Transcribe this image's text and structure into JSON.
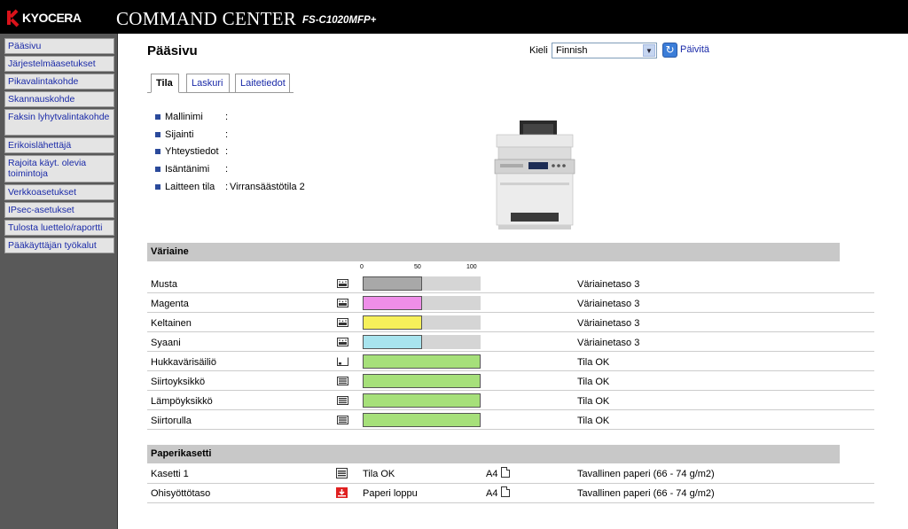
{
  "header": {
    "brand": "KYOCERA",
    "app_title": "COMMAND CENTER",
    "model": "FS-C1020MFP+"
  },
  "sidebar": {
    "items": [
      {
        "label": "Pääsivu"
      },
      {
        "label": "Järjestelmäasetukset"
      },
      {
        "label": "Pikavalintakohde"
      },
      {
        "label": "Skannauskohde"
      },
      {
        "label": "Faksin lyhytvalintakohde"
      },
      {
        "label": "Erikoislähettäjä"
      },
      {
        "label": "Rajoita käyt. olevia toimintoja"
      },
      {
        "label": "Verkkoasetukset"
      },
      {
        "label": "IPsec-asetukset"
      },
      {
        "label": "Tulosta luettelo/raportti"
      },
      {
        "label": "Pääkäyttäjän työkalut"
      }
    ]
  },
  "main": {
    "title": "Pääsivu",
    "language_label": "Kieli",
    "language_value": "Finnish",
    "refresh_label": "Päivitä",
    "tabs": [
      {
        "label": "Tila",
        "active": true
      },
      {
        "label": "Laskuri",
        "active": false
      },
      {
        "label": "Laitetiedot",
        "active": false
      }
    ],
    "info": [
      {
        "label": "Mallinimi",
        "sep": ":",
        "value": ""
      },
      {
        "label": "Sijainti",
        "sep": ":",
        "value": ""
      },
      {
        "label": "Yhteystiedot",
        "sep": ":",
        "value": ""
      },
      {
        "label": "Isäntänimi",
        "sep": ":",
        "value": ""
      },
      {
        "label": "Laitteen tila",
        "sep": ":",
        "value": "Virransäästötila 2"
      }
    ]
  },
  "toner_section": {
    "title": "Väriaine",
    "scale": [
      "0",
      "50",
      "100"
    ],
    "rows": [
      {
        "name": "Musta",
        "level": 50,
        "color": "#a8a8a8",
        "status": "Väriainetaso 3",
        "icon": "toner-icon"
      },
      {
        "name": "Magenta",
        "level": 50,
        "color": "#ee8ee8",
        "status": "Väriainetaso 3",
        "icon": "toner-icon"
      },
      {
        "name": "Keltainen",
        "level": 50,
        "color": "#f6f05a",
        "status": "Väriainetaso 3",
        "icon": "toner-icon"
      },
      {
        "name": "Syaani",
        "level": 50,
        "color": "#a8e4ee",
        "status": "Väriainetaso 3",
        "icon": "toner-icon"
      },
      {
        "name": "Hukkavärisäiliö",
        "level": 100,
        "color": "#a6e07a",
        "status": "Tila OK",
        "icon": "waste-box-icon"
      },
      {
        "name": "Siirtoyksikkö",
        "level": 100,
        "color": "#a6e07a",
        "status": "Tila OK",
        "icon": "unit-icon"
      },
      {
        "name": "Lämpöyksikkö",
        "level": 100,
        "color": "#a6e07a",
        "status": "Tila OK",
        "icon": "unit-icon"
      },
      {
        "name": "Siirtorulla",
        "level": 100,
        "color": "#a6e07a",
        "status": "Tila OK",
        "icon": "unit-icon"
      }
    ]
  },
  "tray_section": {
    "title": "Paperikasetti",
    "rows": [
      {
        "name": "Kasetti 1",
        "state": "Tila OK",
        "size": "A4",
        "paper": "Tavallinen paperi (66 - 74 g/m2)",
        "icon": "tray-ok-icon",
        "icon_color": "#333333"
      },
      {
        "name": "Ohisyöttötaso",
        "state": "Paperi loppu",
        "size": "A4",
        "paper": "Tavallinen paperi (66 - 74 g/m2)",
        "icon": "tray-empty-icon",
        "icon_color": "#e02020"
      }
    ]
  }
}
